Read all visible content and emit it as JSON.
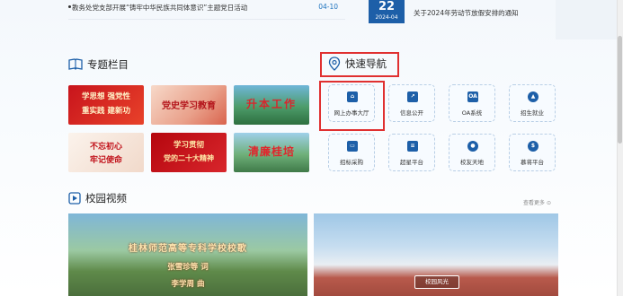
{
  "news": {
    "left_title": "教务处党支部开展“铸牢中华民族共同体意识”主题党日活动",
    "left_date": "04-10",
    "date_day": "22",
    "date_ym": "2024-04",
    "right_title": "关于2024年劳动节放假安排的通知"
  },
  "topics": {
    "title": "专题栏目",
    "banners": [
      {
        "lines": [
          "学思想 强党性",
          "重实践 建新功"
        ]
      },
      {
        "lines": [
          "党史学习教育"
        ]
      },
      {
        "lines": [
          "升本工作"
        ]
      },
      {
        "lines": [
          "不忘初心",
          "牢记使命"
        ]
      },
      {
        "lines": [
          "学习贯彻",
          "党的二十大精神"
        ]
      },
      {
        "lines": [
          "清廉桂培"
        ]
      }
    ]
  },
  "quicknav": {
    "title": "快速导航",
    "items": [
      {
        "label": "网上办事大厅",
        "icon": "building-icon",
        "glyph": "⌂"
      },
      {
        "label": "信息公开",
        "icon": "chart-icon",
        "glyph": "↗"
      },
      {
        "label": "OA系统",
        "icon": "oa-icon",
        "glyph": "OA"
      },
      {
        "label": "招生就业",
        "icon": "graduation-cap-icon",
        "glyph": "▲"
      },
      {
        "label": "招标采购",
        "icon": "monitor-icon",
        "glyph": "▭"
      },
      {
        "label": "超星平台",
        "icon": "books-icon",
        "glyph": "≡"
      },
      {
        "label": "校友天地",
        "icon": "people-icon",
        "glyph": "●"
      },
      {
        "label": "慕将平台",
        "icon": "dollar-icon",
        "glyph": "$"
      }
    ]
  },
  "videos": {
    "title": "校园视频",
    "more_label": "查看更多",
    "left_lines": [
      "桂林师范高等专科学校校歌",
      "张雪珍等   词",
      "李学周   曲"
    ],
    "right_button": "校园风光"
  },
  "colors": {
    "accent": "#1d5fa8",
    "highlight": "#e03030"
  }
}
